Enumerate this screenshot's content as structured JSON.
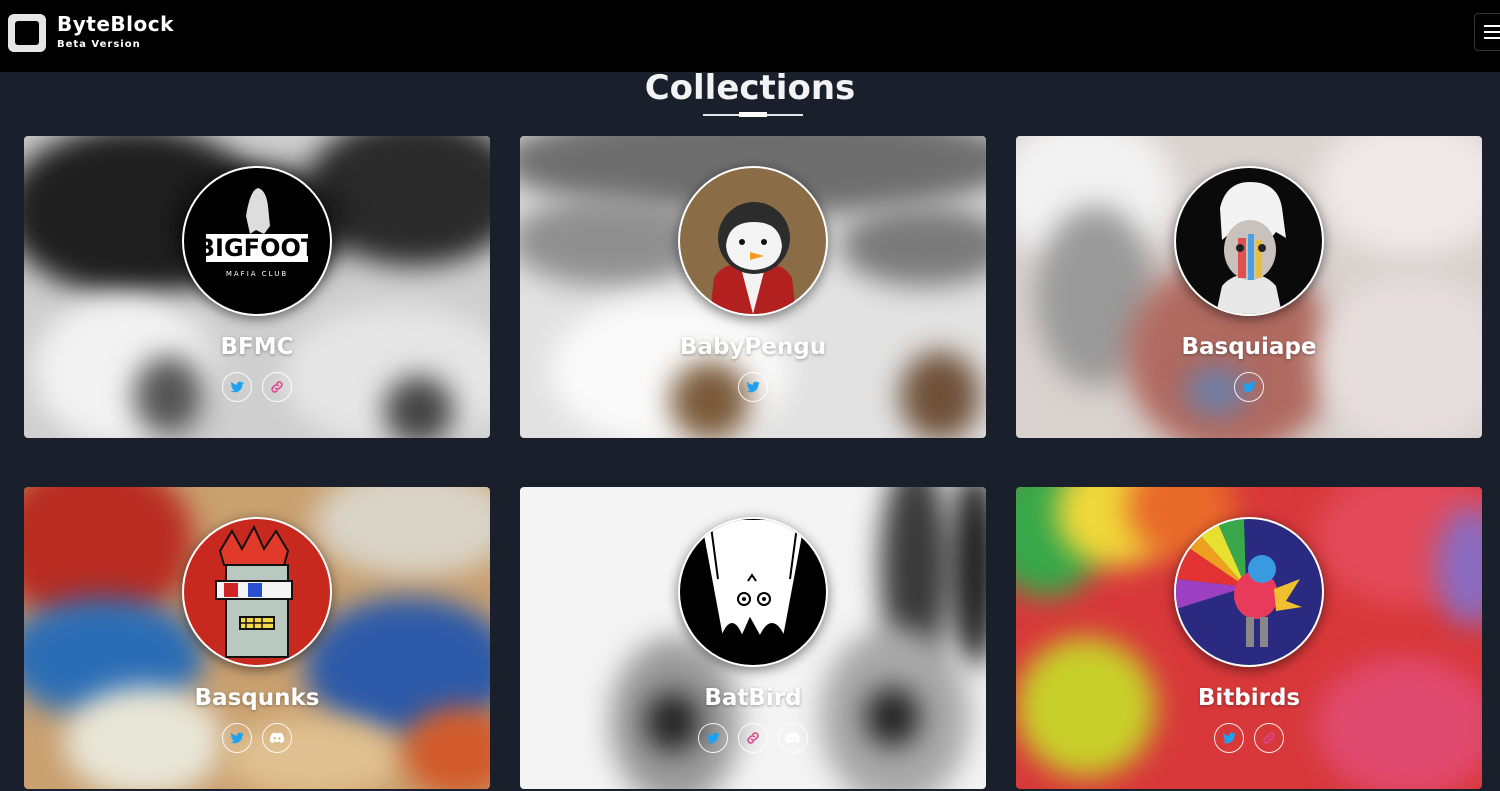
{
  "header": {
    "brand": "ByteBlock",
    "subtitle": "Beta Version",
    "menu_icon": "hamburger-icon"
  },
  "page": {
    "title": "Collections"
  },
  "colors": {
    "background": "#1a202b",
    "header": "#000000",
    "twitter": "#1da1f2",
    "discord": "#ffffff",
    "link_gradient": [
      "#f05a28",
      "#c13584",
      "#5851db"
    ]
  },
  "collections": [
    {
      "name": "BFMC",
      "socials": [
        "twitter-icon",
        "link-icon"
      ]
    },
    {
      "name": "BabyPengu",
      "socials": [
        "twitter-icon"
      ]
    },
    {
      "name": "Basquiape",
      "socials": [
        "twitter-icon"
      ]
    },
    {
      "name": "Basqunks",
      "socials": [
        "twitter-icon",
        "discord-icon"
      ]
    },
    {
      "name": "BatBird",
      "socials": [
        "twitter-icon",
        "link-icon",
        "discord-icon"
      ]
    },
    {
      "name": "Bitbirds",
      "socials": [
        "twitter-icon",
        "link-icon"
      ]
    }
  ]
}
